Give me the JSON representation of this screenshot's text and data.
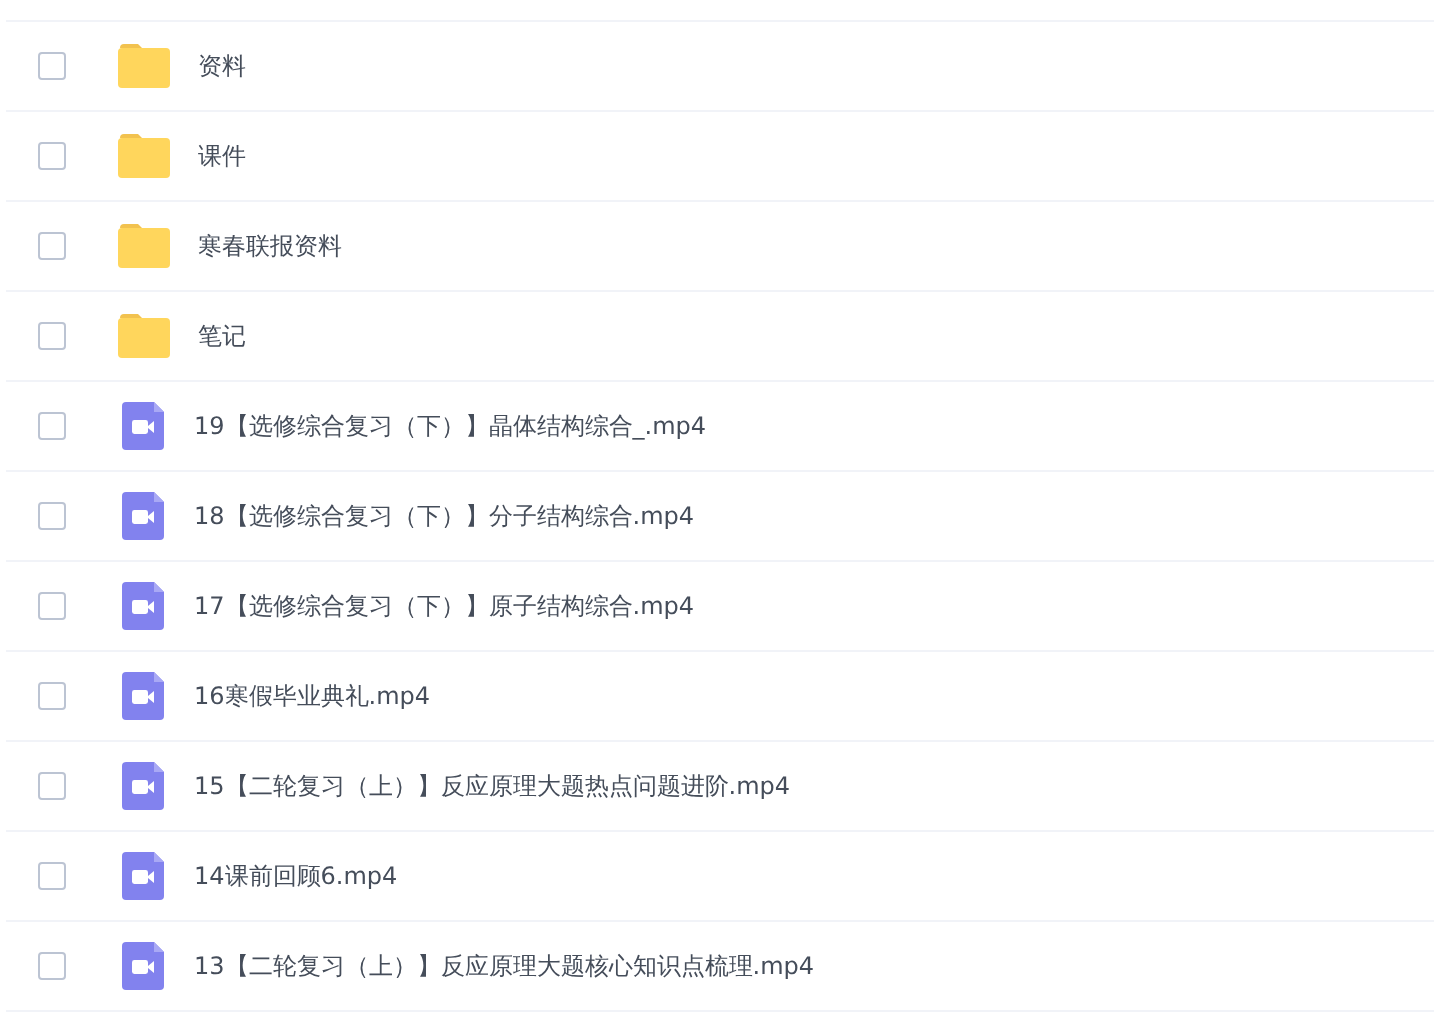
{
  "files": [
    {
      "kind": "folder",
      "name": "资料",
      "checked": false
    },
    {
      "kind": "folder",
      "name": "课件",
      "checked": false
    },
    {
      "kind": "folder",
      "name": "寒春联报资料",
      "checked": false
    },
    {
      "kind": "folder",
      "name": "笔记",
      "checked": false
    },
    {
      "kind": "video",
      "name": "19【选修综合复习（下）】晶体结构综合_.mp4",
      "checked": false
    },
    {
      "kind": "video",
      "name": "18【选修综合复习（下）】分子结构综合.mp4",
      "checked": false
    },
    {
      "kind": "video",
      "name": "17【选修综合复习（下）】原子结构综合.mp4",
      "checked": false
    },
    {
      "kind": "video",
      "name": "16寒假毕业典礼.mp4",
      "checked": false
    },
    {
      "kind": "video",
      "name": "15【二轮复习（上）】反应原理大题热点问题进阶.mp4",
      "checked": false
    },
    {
      "kind": "video",
      "name": "14课前回顾6.mp4",
      "checked": false
    },
    {
      "kind": "video",
      "name": "13【二轮复习（上）】反应原理大题核心知识点梳理.mp4",
      "checked": false
    }
  ]
}
